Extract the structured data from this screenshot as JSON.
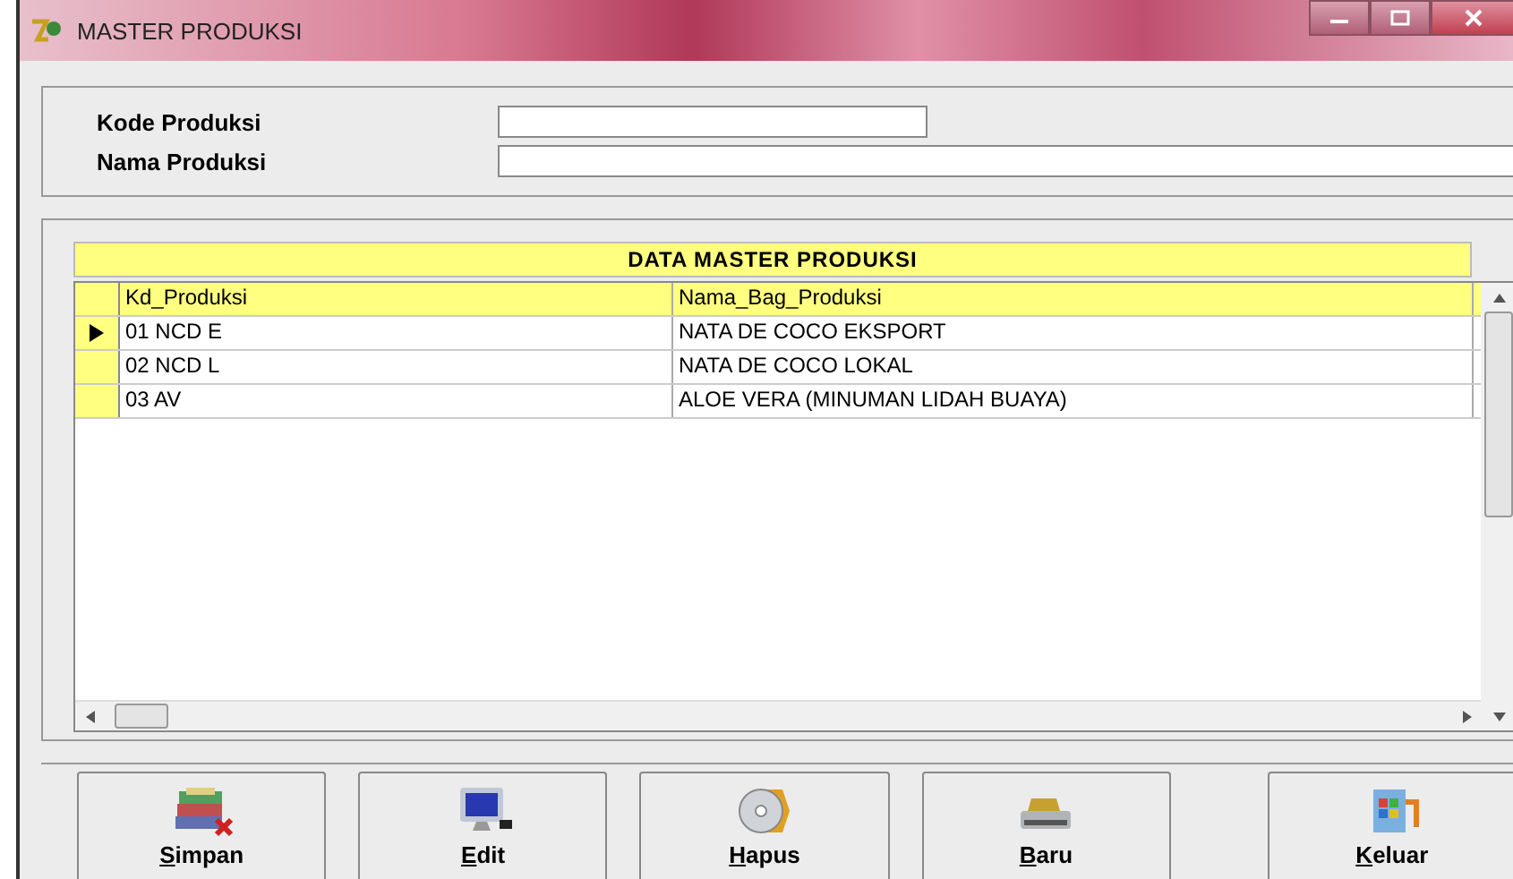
{
  "window": {
    "title": "MASTER PRODUKSI"
  },
  "form": {
    "fields": [
      {
        "label": "Kode Produksi"
      },
      {
        "label": "Nama Produksi"
      }
    ]
  },
  "grid": {
    "title": "DATA MASTER PRODUKSI",
    "columns": [
      "Kd_Produksi",
      "Nama_Bag_Produksi"
    ],
    "rows": [
      {
        "cells": [
          "01 NCD E",
          "NATA DE COCO EKSPORT"
        ],
        "selected": true
      },
      {
        "cells": [
          "02 NCD L",
          "NATA DE COCO LOKAL"
        ],
        "selected": false
      },
      {
        "cells": [
          "03 AV",
          "ALOE VERA (MINUMAN LIDAH BUAYA)"
        ],
        "selected": false
      }
    ]
  },
  "buttons": [
    {
      "label": "Simpan",
      "kind": "books"
    },
    {
      "label": "Edit",
      "kind": "monitor"
    },
    {
      "label": "Hapus",
      "kind": "disc"
    },
    {
      "label": "Baru",
      "kind": "printer"
    },
    {
      "label": "Keluar",
      "kind": "exit"
    }
  ]
}
